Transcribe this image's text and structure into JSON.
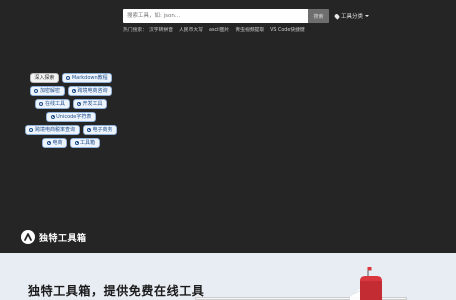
{
  "search": {
    "placeholder": "搜索工具，如: json...",
    "button_label": "搜索"
  },
  "header": {
    "tools_category_label": "工具分类"
  },
  "hot": {
    "prefix": "热门搜索：",
    "items": [
      "汉字转拼音",
      "人民币大写",
      "ascii图片",
      "青虫视频提取",
      "VS Code快捷键"
    ]
  },
  "tags": [
    {
      "label": "深入探索",
      "icon": false
    },
    {
      "label": "Markdown教程",
      "icon": true
    },
    {
      "label": "加密解密",
      "icon": true
    },
    {
      "label": "跨境电商咨询",
      "icon": true
    },
    {
      "label": "在线工具",
      "icon": true
    },
    {
      "label": "开发工具",
      "icon": true
    },
    {
      "label": "Unicode字符表",
      "icon": true
    },
    {
      "label": "跨境电商税率查询",
      "icon": true
    },
    {
      "label": "电子商务",
      "icon": true
    },
    {
      "label": "电商",
      "icon": true
    },
    {
      "label": "工具箱",
      "icon": true
    }
  ],
  "footer": {
    "brand": "独特工具箱"
  },
  "hero": {
    "title": "独特工具箱，提供免费在线工具"
  }
}
